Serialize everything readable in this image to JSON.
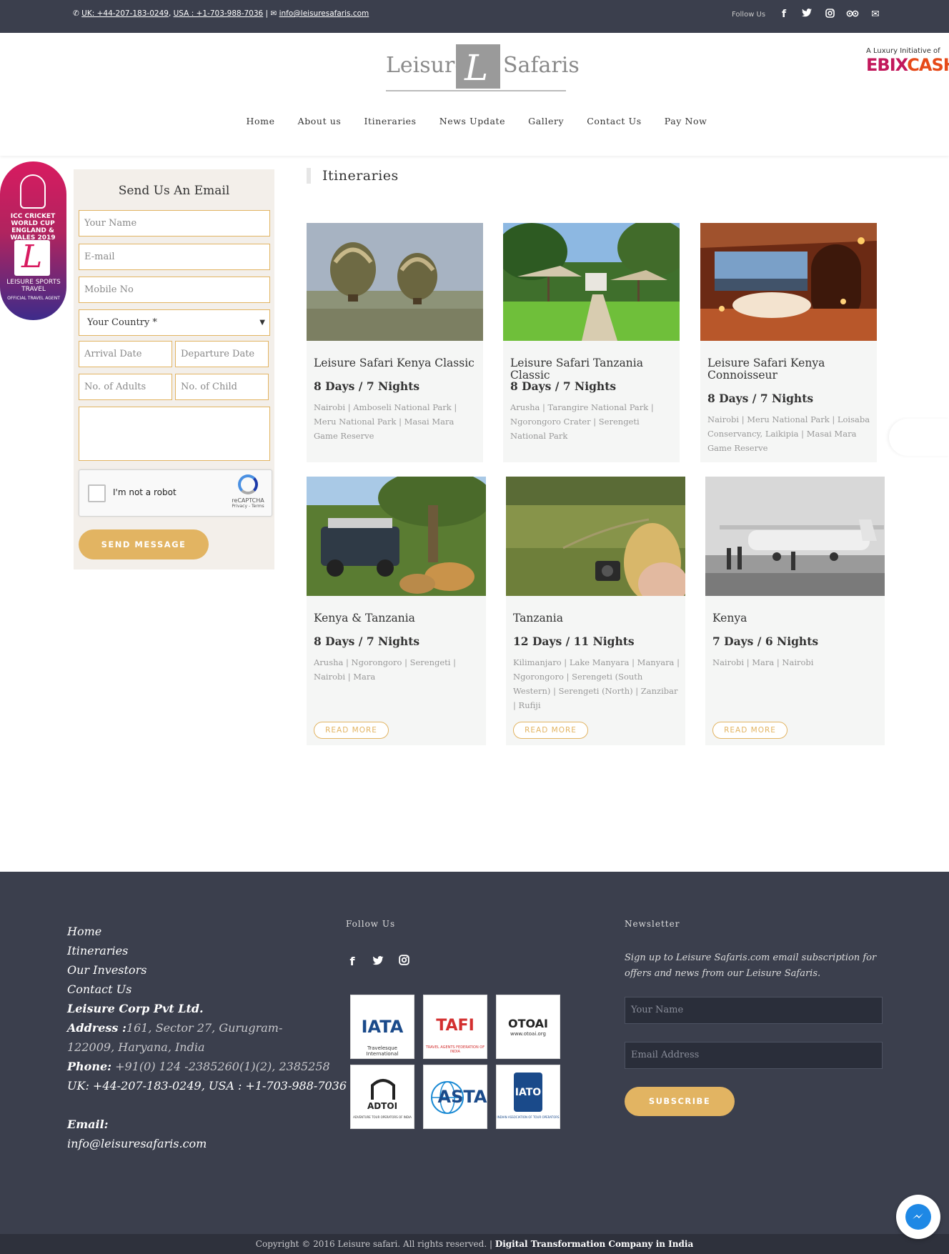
{
  "topbar": {
    "phone_icon": "phone-icon",
    "uk": "UK: +44-207-183-0249",
    "usa": "USA : +1-703-988-7036",
    "sep": ", ",
    "bar": " | ",
    "mail_icon": "envelope-icon",
    "email": "info@leisuresafaris.com",
    "follow_label": "Follow Us",
    "socials": [
      "f",
      "t",
      "ig",
      "ta",
      "✉"
    ]
  },
  "header": {
    "logo_left": "Leisure",
    "logo_mark": "L",
    "logo_right": "Safaris",
    "ebix_small": "A Luxury Initiative of",
    "ebix_e": "EBIX",
    "ebix_c": "CASH",
    "nav": [
      "Home",
      "About us",
      "Itineraries",
      "News Update",
      "Gallery",
      "Contact Us",
      "Pay Now"
    ]
  },
  "badge": {
    "event": "ICC CRICKET WORLD CUP ENGLAND & WALES 2019",
    "brand": "LEISURE SPORTS TRAVEL",
    "role": "OFFICIAL TRAVEL AGENT"
  },
  "form": {
    "title": "Send Us An Email",
    "name_placeholder": "Your Name",
    "email_placeholder": "E-mail",
    "mobile_placeholder": "Mobile No",
    "country": "Your Country *",
    "arrival_placeholder": "Arrival Date",
    "departure_placeholder": "Departure Date",
    "adults_placeholder": "No. of Adults",
    "child_placeholder": "No. of Child",
    "captcha_label": "I'm not a robot",
    "captcha_brand": "reCAPTCHA",
    "captcha_links": "Privacy - Terms",
    "submit": "SEND MESSAGE"
  },
  "itineraries": {
    "heading": "Itineraries",
    "read_more": "READ MORE",
    "cards": [
      {
        "title": "Leisure Safari Kenya Classic",
        "duration": "8 Days / 7 Nights",
        "places": "Nairobi | Amboseli National Park | Meru National Park | Masai Mara Game Reserve",
        "image": "balloons-over-savanna"
      },
      {
        "title": "Leisure Safari Tanzania Classic",
        "duration": "8 Days / 7 Nights",
        "places": "Arusha | Tarangire National Park | Ngorongoro Crater | Serengeti National Park",
        "image": "lodge-garden-umbrellas"
      },
      {
        "title": "Leisure Safari Kenya Connoisseur",
        "duration": "8 Days / 7 Nights",
        "places": "Nairobi | Meru National Park | Loisaba Conservancy, Laikipia | Masai Mara Game Reserve",
        "image": "candlelit-bath-suite"
      },
      {
        "title": "Kenya & Tanzania",
        "duration": "8 Days / 7 Nights",
        "places": "Arusha | Ngorongoro | Serengeti | Nairobi | Mara",
        "image": "jeep-lions"
      },
      {
        "title": "Tanzania",
        "duration": "12 Days / 11 Nights",
        "places": "Kilimanjaro | Lake Manyara | Manyara | Ngorongoro | Serengeti (South Western) | Serengeti (North) | Zanzibar | Rufiji",
        "image": "woman-camera-plains"
      },
      {
        "title": "Kenya",
        "duration": "7 Days / 6 Nights",
        "places": "Nairobi | Mara | Nairobi",
        "image": "bush-plane-bw"
      }
    ]
  },
  "footer": {
    "links": [
      "Home",
      "Itineraries",
      "Our Investors",
      "Contact Us"
    ],
    "company": "Leisure Corp Pvt Ltd.",
    "address_label": "Address :",
    "address": "161, Sector 27, Gurugram-122009, Haryana, India",
    "phone_label": "Phone:",
    "phone": " +91(0) 124 -2385260(1)(2), 2385258",
    "intl": "UK: +44-207-183-0249, USA : +1-703-988-7036",
    "email_label": "Email:",
    "email": "info@leisuresafaris.com",
    "follow_title": "Follow Us",
    "follow_icons": [
      "f",
      "t",
      "ig"
    ],
    "assoc": [
      {
        "name": "IATA",
        "sub": "Travelesque International",
        "color": "#1a4a8a"
      },
      {
        "name": "TAFI",
        "sub": "TRAVEL AGENTS FEDERATION OF INDIA",
        "color": "#d32f2f"
      },
      {
        "name": "OTOAI",
        "sub": "www.otoai.org",
        "color": "#222222"
      },
      {
        "name": "ADTOI",
        "sub": "ADVENTURE TOUR OPERATORS OF INDIA",
        "color": "#222222"
      },
      {
        "name": "ASTA",
        "sub": "",
        "color": "#1a4a8a"
      },
      {
        "name": "IATO",
        "sub": "INDIAN ASSOCIATION OF TOUR OPERATORS",
        "color": "#1a4a8a"
      }
    ],
    "newsletter_title": "Newsletter",
    "newsletter_text": "Sign up to Leisure Safaris.com email subscription for offers and news from our Leisure Safaris.",
    "nl_name_placeholder": "Your Name",
    "nl_email_placeholder": "Email Address",
    "subscribe": "SUBSCRIBE",
    "copyright": "Copyright © 2016 Leisure safari. All rights reserved. | ",
    "copyright_link": "Digital Transformation Company in India"
  },
  "colors": {
    "accent": "#e2b462",
    "dark": "#3b3f4d"
  }
}
